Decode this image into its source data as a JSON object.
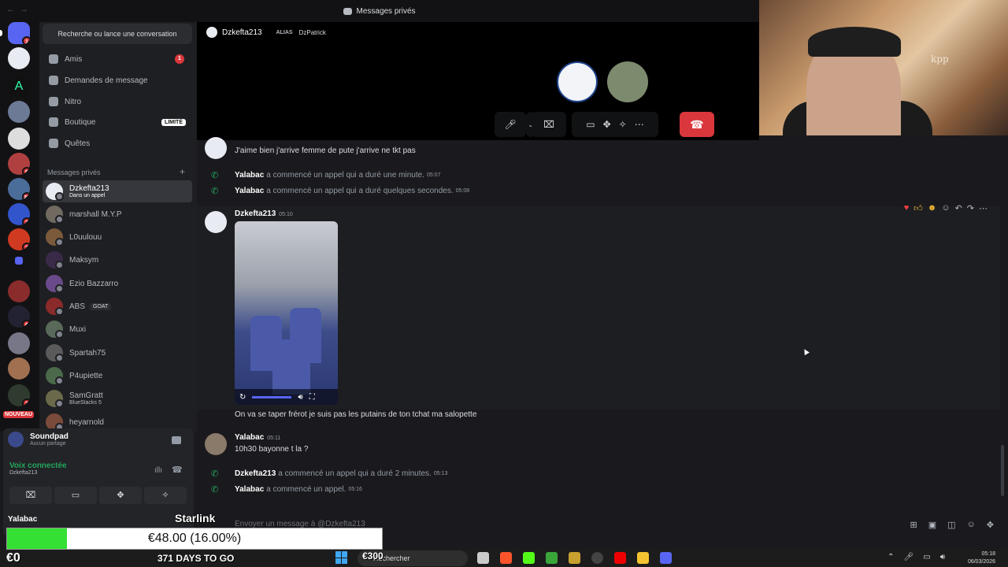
{
  "titlebar": {
    "title": "Messages privés"
  },
  "sidebar": {
    "search_label": "Recherche ou lance une conversation",
    "nav": [
      {
        "label": "Amis",
        "badge": "1"
      },
      {
        "label": "Demandes de message"
      },
      {
        "label": "Nitro"
      },
      {
        "label": "Boutique",
        "tag": "LIMITÉ"
      },
      {
        "label": "Quêtes"
      }
    ],
    "dm_header": "Messages privés",
    "dms": [
      {
        "name": "Dzkefta213",
        "status": "Dans un appel"
      },
      {
        "name": "marshall M.Y.P"
      },
      {
        "name": "L0uulouu"
      },
      {
        "name": "Maksym"
      },
      {
        "name": "Ezio Bazzarro"
      },
      {
        "name": "ABS",
        "tag": "GOAT"
      },
      {
        "name": "Muxi"
      },
      {
        "name": "Spartah75"
      },
      {
        "name": "P4upiette"
      },
      {
        "name": "SamGratt",
        "status": "BlueStacks 5"
      },
      {
        "name": "heyarnold"
      }
    ],
    "rail_badges": [
      "1",
      "6",
      "9",
      "25",
      "2",
      "2",
      "6",
      "3"
    ],
    "rail_new": "NOUVEAU"
  },
  "panel": {
    "soundpad_title": "Soundpad",
    "soundpad_sub": "Aucun partage",
    "voice_title": "Voix connectée",
    "voice_sub": "Dzkefta213",
    "user": "Yalabac"
  },
  "call": {
    "user": "Dzkefta213",
    "alias_label": "ALIAS",
    "alias_value": "DzPatrick"
  },
  "webcam": {
    "caption": "kpp"
  },
  "messages": {
    "top_text": "J'aime bien j'arrive femme de pute j'arrive ne tkt pas",
    "calls1": [
      {
        "user": "Yalabac",
        "text": "a commencé un appel qui a duré une minute.",
        "ts": "05:07"
      },
      {
        "user": "Yalabac",
        "text": "a commencé un appel qui a duré quelques secondes.",
        "ts": "05:08"
      }
    ],
    "msg1": {
      "author": "Dzkefta213",
      "ts": "05:10",
      "text": "On va se taper frérot je suis pas les putains de ton tchat ma salopette"
    },
    "msg2": {
      "author": "Yalabac",
      "ts": "05:11",
      "text": "10h30 bayonne t la ?"
    },
    "calls2": [
      {
        "user": "Dzkefta213",
        "text": "a commencé un appel qui a duré 2 minutes.",
        "ts": "05:13"
      },
      {
        "user": "Yalabac",
        "text": "a commencé un appel.",
        "ts": "05:16"
      }
    ]
  },
  "input": {
    "placeholder": "Envoyer un message à @Dzkefta213"
  },
  "overlay": {
    "starlink": "Starlink",
    "progress_label": "€48.00 (16.00%)",
    "progress_value": 0.16,
    "zero": "€0",
    "days": "371 DAYS TO GO",
    "t300": "€300"
  },
  "taskbar": {
    "search": "Rechercher",
    "time": "05:18",
    "date": "06/03/2026"
  },
  "colors": {
    "accent": "#5865f2",
    "online": "#23a55a",
    "danger": "#da373c",
    "progress": "#33e033"
  }
}
